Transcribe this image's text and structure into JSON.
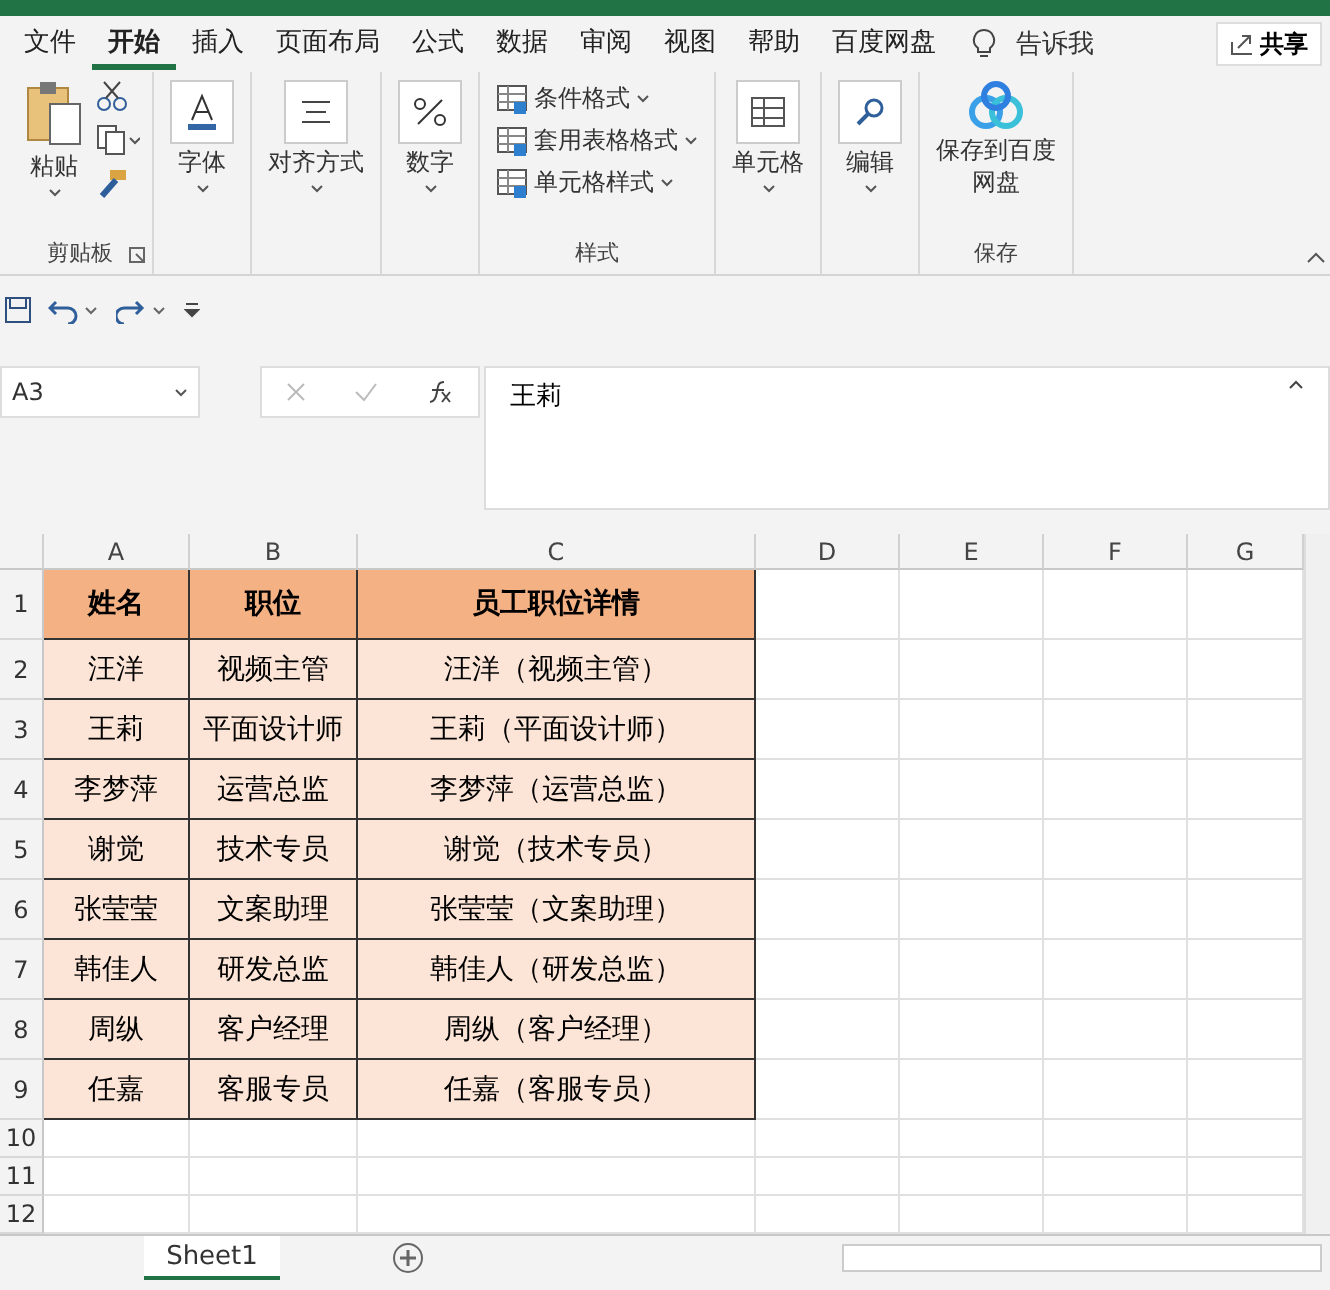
{
  "ribbon_tabs": [
    {
      "label": "文件",
      "selected": false
    },
    {
      "label": "开始",
      "selected": true
    },
    {
      "label": "插入",
      "selected": false
    },
    {
      "label": "页面布局",
      "selected": false
    },
    {
      "label": "公式",
      "selected": false
    },
    {
      "label": "数据",
      "selected": false
    },
    {
      "label": "审阅",
      "selected": false
    },
    {
      "label": "视图",
      "selected": false
    },
    {
      "label": "帮助",
      "selected": false
    },
    {
      "label": "百度网盘",
      "selected": false
    }
  ],
  "tell_me": "告诉我",
  "share": "共享",
  "ribbon_groups": [
    {
      "kind": "clipboard",
      "label": "剪贴板",
      "button": "粘贴"
    },
    {
      "kind": "font",
      "button": "字体"
    },
    {
      "kind": "alignment",
      "button": "对齐方式"
    },
    {
      "kind": "number",
      "button": "数字"
    },
    {
      "kind": "styles",
      "label": "样式",
      "items": [
        "条件格式",
        "套用表格格式",
        "单元格样式"
      ]
    },
    {
      "kind": "cells",
      "button": "单元格"
    },
    {
      "kind": "editing",
      "button": "编辑"
    },
    {
      "kind": "save",
      "label": "保存",
      "button": "保存到百度网盘"
    }
  ],
  "name_box": "A3",
  "formula": "王莉",
  "columns": [
    "A",
    "B",
    "C",
    "D",
    "E",
    "F",
    "G"
  ],
  "rows": [
    {
      "number": "1",
      "kind": "header",
      "cells": [
        "姓名",
        "职位",
        "员工职位详情"
      ]
    },
    {
      "number": "2",
      "kind": "data",
      "cells": [
        "汪洋",
        "视频主管",
        "汪洋（视频主管）"
      ]
    },
    {
      "number": "3",
      "kind": "data",
      "cells": [
        "王莉",
        "平面设计师",
        "王莉（平面设计师）"
      ]
    },
    {
      "number": "4",
      "kind": "data",
      "cells": [
        "李梦萍",
        "运营总监",
        "李梦萍（运营总监）"
      ]
    },
    {
      "number": "5",
      "kind": "data",
      "cells": [
        "谢觉",
        "技术专员",
        "谢觉（技术专员）"
      ]
    },
    {
      "number": "6",
      "kind": "data",
      "cells": [
        "张莹莹",
        "文案助理",
        "张莹莹（文案助理）"
      ]
    },
    {
      "number": "7",
      "kind": "data",
      "cells": [
        "韩佳人",
        "研发总监",
        "韩佳人（研发总监）"
      ]
    },
    {
      "number": "8",
      "kind": "data",
      "cells": [
        "周纵",
        "客户经理",
        "周纵（客户经理）"
      ]
    },
    {
      "number": "9",
      "kind": "data",
      "cells": [
        "任嘉",
        "客服专员",
        "任嘉（客服专员）"
      ]
    },
    {
      "number": "10",
      "kind": "empty"
    },
    {
      "number": "11",
      "kind": "empty"
    },
    {
      "number": "12",
      "kind": "empty"
    }
  ],
  "sheet_tabs": [
    {
      "label": "Sheet1",
      "selected": true
    }
  ]
}
